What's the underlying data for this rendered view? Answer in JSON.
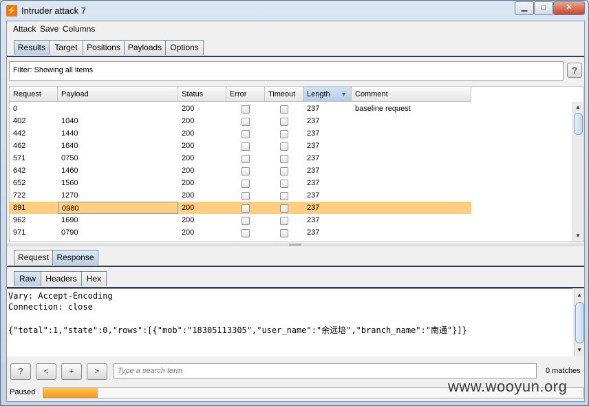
{
  "window": {
    "title": "Intruder attack 7",
    "app_icon_glyph": "⚡"
  },
  "menu": {
    "items": [
      "Attack",
      "Save",
      "Columns"
    ]
  },
  "main_tabs": [
    {
      "label": "Results",
      "active": true
    },
    {
      "label": "Target",
      "active": false
    },
    {
      "label": "Positions",
      "active": false
    },
    {
      "label": "Payloads",
      "active": false
    },
    {
      "label": "Options",
      "active": false
    }
  ],
  "filter": {
    "text": "Filter: Showing all items",
    "help_label": "?"
  },
  "table": {
    "columns": [
      "Request",
      "Payload",
      "Status",
      "Error",
      "Timeout",
      "Length",
      "Comment"
    ],
    "sorted_column": "Length",
    "rows": [
      {
        "request": "0",
        "payload": "",
        "status": "200",
        "error": false,
        "timeout": false,
        "length": "237",
        "comment": "baseline request"
      },
      {
        "request": "402",
        "payload": "1040",
        "status": "200",
        "error": false,
        "timeout": false,
        "length": "237",
        "comment": ""
      },
      {
        "request": "442",
        "payload": "1440",
        "status": "200",
        "error": false,
        "timeout": false,
        "length": "237",
        "comment": ""
      },
      {
        "request": "462",
        "payload": "1640",
        "status": "200",
        "error": false,
        "timeout": false,
        "length": "237",
        "comment": ""
      },
      {
        "request": "571",
        "payload": "0750",
        "status": "200",
        "error": false,
        "timeout": false,
        "length": "237",
        "comment": ""
      },
      {
        "request": "642",
        "payload": "1460",
        "status": "200",
        "error": false,
        "timeout": false,
        "length": "237",
        "comment": ""
      },
      {
        "request": "652",
        "payload": "1560",
        "status": "200",
        "error": false,
        "timeout": false,
        "length": "237",
        "comment": ""
      },
      {
        "request": "722",
        "payload": "1270",
        "status": "200",
        "error": false,
        "timeout": false,
        "length": "237",
        "comment": ""
      },
      {
        "request": "891",
        "payload": "0980",
        "status": "200",
        "error": false,
        "timeout": false,
        "length": "237",
        "comment": "",
        "selected": true
      },
      {
        "request": "962",
        "payload": "1690",
        "status": "200",
        "error": false,
        "timeout": false,
        "length": "237",
        "comment": ""
      },
      {
        "request": "971",
        "payload": "0790",
        "status": "200",
        "error": false,
        "timeout": false,
        "length": "237",
        "comment": ""
      }
    ]
  },
  "detail_tabs": [
    {
      "label": "Request",
      "active": false
    },
    {
      "label": "Response",
      "active": true
    }
  ],
  "view_tabs": [
    {
      "label": "Raw",
      "active": true
    },
    {
      "label": "Headers",
      "active": false
    },
    {
      "label": "Hex",
      "active": false
    }
  ],
  "response": {
    "lines": [
      "Vary: Accept-Encoding",
      "Connection: close",
      "",
      "{\"total\":1,\"state\":0,\"rows\":[{\"mob\":\"18305113305\",\"user_name\":\"余远培\",\"branch_name\":\"南通\"}]}"
    ]
  },
  "search": {
    "help_label": "?",
    "prev_label": "<",
    "add_label": "+",
    "next_label": ">",
    "placeholder": "Type a search term",
    "matches": "0 matches"
  },
  "status": {
    "label": "Paused",
    "progress": 0.1
  },
  "watermark": "www.wooyun.org",
  "colors": {
    "selected_row": "#fecf82",
    "progress": "#f09a19",
    "active_tab": "#bcd0e5"
  }
}
